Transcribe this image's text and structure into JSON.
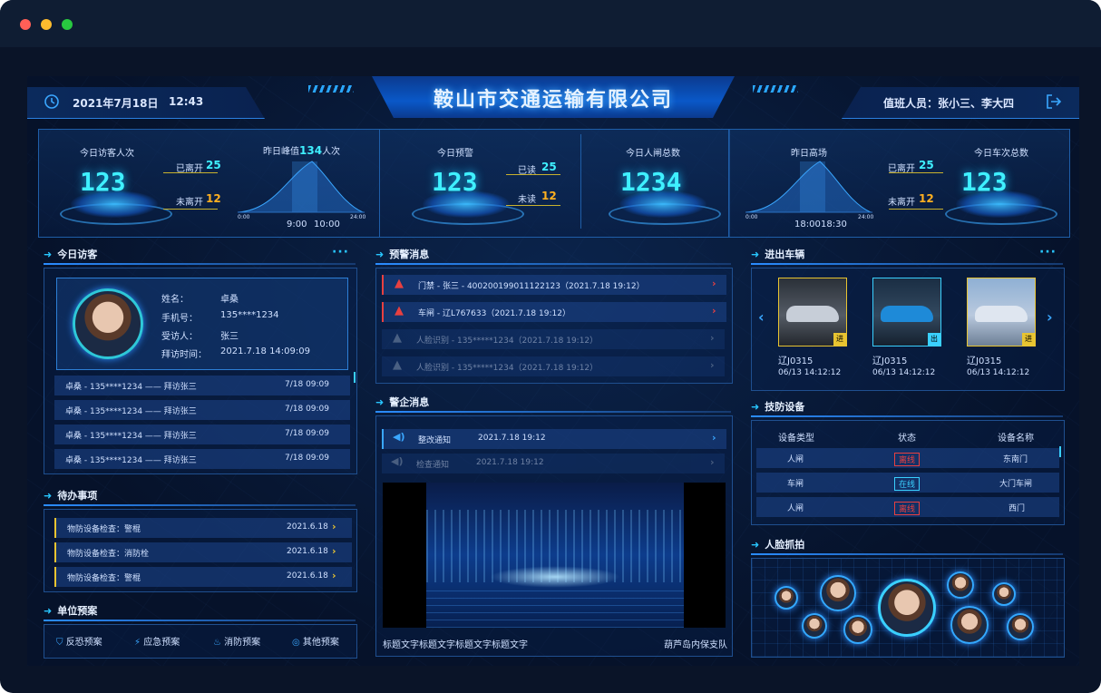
{
  "header": {
    "date": "2021年7月18日",
    "time": "12:43",
    "company": "鞍山市交通运输有限公司",
    "duty": "值班人员：张小三、李大四"
  },
  "visitors": {
    "label": "今日访客人次",
    "value": "123",
    "left_label": "已离开",
    "left_value": "25",
    "notleft_label": "未离开",
    "notleft_value": "12",
    "peak_prefix": "昨日峰值",
    "peak_value": "134",
    "peak_suffix": "人次",
    "t1": "9:00",
    "t2": "10:00",
    "x0": "0:00",
    "x1": "24:00"
  },
  "alerts_stat": {
    "label": "今日预警",
    "value": "123",
    "read_label": "已读",
    "read_value": "25",
    "unread_label": "未读",
    "unread_value": "12"
  },
  "gate": {
    "label": "今日人闸总数",
    "value": "1234"
  },
  "vehicles_stat": {
    "label": "今日车次总数",
    "value": "123",
    "left_label": "已离开",
    "left_value": "25",
    "notleft_label": "未离开",
    "notleft_value": "12",
    "peak_label": "昨日高场",
    "t1": "18:00",
    "t2": "18:30",
    "x0": "0:00",
    "x1": "24:00"
  },
  "today_visitors": {
    "title": "今日访客",
    "more": "···",
    "card": {
      "name_label": "姓名：",
      "name": "卓桑",
      "phone_label": "手机号：",
      "phone": "135****1234",
      "host_label": "受访人：",
      "host": "张三",
      "time_label": "拜访时间：",
      "time": "2021.7.18 14:09:09"
    },
    "rows": [
      {
        "text": "卓桑 - 135****1234  ——  拜访张三",
        "time": "7/18 09:09"
      },
      {
        "text": "卓桑 - 135****1234  ——  拜访张三",
        "time": "7/18 09:09"
      },
      {
        "text": "卓桑 - 135****1234  ——  拜访张三",
        "time": "7/18 09:09"
      },
      {
        "text": "卓桑 - 135****1234  ——  拜访张三",
        "time": "7/18 09:09"
      }
    ]
  },
  "todo": {
    "title": "待办事项",
    "rows": [
      {
        "text": "物防设备检查：警棍",
        "date": "2021.6.18"
      },
      {
        "text": "物防设备检查：消防栓",
        "date": "2021.6.18"
      },
      {
        "text": "物防设备检查：警棍",
        "date": "2021.6.18"
      }
    ]
  },
  "plans": {
    "title": "单位预案",
    "items": [
      "反恐预案",
      "应急预案",
      "消防预案",
      "其他预案"
    ]
  },
  "warnings": {
    "title": "预警消息",
    "rows": [
      {
        "text": "门禁 - 张三 - 400200199011122123（2021.7.18 19:12）",
        "active": true
      },
      {
        "text": "车闸 - 辽L767633（2021.7.18 19:12）",
        "active": true
      },
      {
        "text": "人脸识别 - 135*****1234（2021.7.18 19:12）",
        "active": false
      },
      {
        "text": "人脸识别 - 135*****1234（2021.7.18 19:12）",
        "active": false
      }
    ]
  },
  "police": {
    "title": "警企消息",
    "rows": [
      {
        "label": "整改通知",
        "time": "2021.7.18 19:12",
        "active": true
      },
      {
        "label": "检查通知",
        "time": "2021.7.18 19:12",
        "active": false
      }
    ],
    "video_caption": "标题文字标题文字标题文字标题文字",
    "video_source": "葫芦岛内保支队"
  },
  "vehicles": {
    "title": "进出车辆",
    "more": "···",
    "cars": [
      {
        "plate": "辽J0315",
        "time": "06/13  14:12:12",
        "tag": "进",
        "color": "#c7ced8"
      },
      {
        "plate": "辽J0315",
        "time": "06/13  14:12:12",
        "tag": "出",
        "color": "#1e8ad8"
      },
      {
        "plate": "辽J0315",
        "time": "06/13  14:12:12",
        "tag": "进",
        "color": "#dfe6f0"
      }
    ]
  },
  "devices": {
    "title": "技防设备",
    "headers": [
      "设备类型",
      "状态",
      "设备名称"
    ],
    "rows": [
      {
        "type": "人闸",
        "status": "离线",
        "name": "东南门",
        "online": false
      },
      {
        "type": "车闸",
        "status": "在线",
        "name": "大门车闸",
        "online": true
      },
      {
        "type": "人闸",
        "status": "离线",
        "name": "西门",
        "online": false
      }
    ]
  },
  "faces": {
    "title": "人脸抓拍"
  },
  "colors": {
    "accent": "#3ff0ff",
    "warn": "#ffb020",
    "red": "#e84040"
  }
}
